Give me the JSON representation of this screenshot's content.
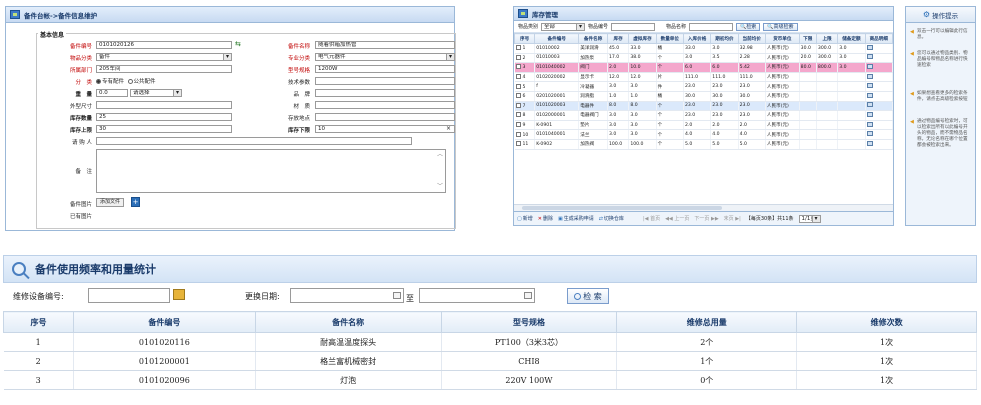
{
  "panel1": {
    "title": "备件台帐->备件信息维护",
    "section": "基本信息",
    "fields": {
      "part_no_label": "备件编号",
      "part_no": "0101020126",
      "part_name_label": "备件名称",
      "part_name": "随着供箱加热管",
      "category_label": "物品分类",
      "category": "备件",
      "major_label": "专业分类",
      "major": "电气元器件",
      "dept_label": "所属部门",
      "dept": "205车间",
      "model_label": "型号规格",
      "model": "1200W",
      "type_label": "分　类",
      "type_opt1": "专有配件",
      "type_opt2": "公共配件",
      "tech_label": "技术参数",
      "weight_label": "重　量",
      "weight": "0.0",
      "weight_unit": "请选择",
      "brand_label": "品　牌",
      "size_label": "外型尺寸",
      "material_label": "材　质",
      "stock_label": "库存数量",
      "stock": "25",
      "location_label": "存放地点",
      "max_label": "库存上限",
      "max": "30",
      "min_label": "库存下限",
      "min": "10",
      "applicant_label": "请 购 人",
      "note_label": "备　注",
      "pic_label": "备件图片",
      "add_file": "添加文件",
      "has_pic_label": "已有图片"
    }
  },
  "panel2": {
    "title": "库存管理",
    "search": {
      "cat_label": "物品类别",
      "cat_value": "全部",
      "code_label": "物品编号",
      "name_label": "物品名称",
      "search_btn": "检索",
      "adv_btn": "高级检索"
    },
    "columns": [
      "序号",
      "备件编号",
      "备件名称",
      "库存",
      "虚拟库存",
      "数量单位",
      "入库价格",
      "期初均价",
      "当前均价",
      "货币单位",
      "下限",
      "上限",
      "储备定额",
      "商品明细"
    ],
    "rows": [
      [
        "1",
        "01010002",
        "美洋润滑",
        "45.0",
        "33.0",
        "桶",
        "33.0",
        "3.0",
        "32.98",
        "人民币(元)",
        "30.0",
        "300.0",
        "3.0",
        ""
      ],
      [
        "2",
        "01010003",
        "加热泵",
        "17.0",
        "38.0",
        "个",
        "3.0",
        "3.5",
        "2.28",
        "人民币(元)",
        "20.0",
        "300.0",
        "3.0",
        ""
      ],
      [
        "3",
        "0101040002",
        "阀门",
        "2.0",
        "10.0",
        "个",
        "6.0",
        "6.0",
        "5.42",
        "人民币(元)",
        "80.0",
        "800.0",
        "3.0",
        ""
      ],
      [
        "4",
        "0102020002",
        "显示卡",
        "12.0",
        "12.0",
        "片",
        "111.0",
        "111.0",
        "111.0",
        "人民币(元)",
        "",
        "",
        "",
        ""
      ],
      [
        "5",
        "f",
        "冷凝器",
        "3.0",
        "3.0",
        "件",
        "23.0",
        "23.0",
        "23.0",
        "人民币(元)",
        "",
        "",
        "",
        ""
      ],
      [
        "6",
        "0201020001",
        "润滑脂",
        "1.0",
        "1.0",
        "桶",
        "30.0",
        "30.0",
        "30.0",
        "人民币(元)",
        "",
        "",
        "",
        ""
      ],
      [
        "7",
        "0101020003",
        "电器件",
        "8.0",
        "8.0",
        "个",
        "23.0",
        "23.0",
        "23.0",
        "人民币(元)",
        "",
        "",
        "",
        ""
      ],
      [
        "8",
        "0102000001",
        "电器阀门",
        "3.0",
        "3.0",
        "个",
        "23.0",
        "23.0",
        "23.0",
        "人民币(元)",
        "",
        "",
        "",
        ""
      ],
      [
        "9",
        "K-0901",
        "垫片",
        "3.0",
        "3.0",
        "个",
        "2.0",
        "2.0",
        "2.0",
        "人民币(元)",
        "",
        "",
        "",
        ""
      ],
      [
        "10",
        "0101040001",
        "法兰",
        "3.0",
        "3.0",
        "个",
        "4.0",
        "4.0",
        "4.0",
        "人民币(元)",
        "",
        "",
        "",
        ""
      ],
      [
        "11",
        "K-0902",
        "加热阀",
        "100.0",
        "100.0",
        "个",
        "5.0",
        "5.0",
        "5.0",
        "人民币(元)",
        "",
        "",
        "",
        ""
      ]
    ],
    "footer": {
      "add": "新增",
      "del": "删除",
      "gen": "生成采购申请",
      "switch": "切换仓库",
      "first": "首页",
      "prev": "上一页",
      "next": "下一页",
      "last": "末页",
      "page_info": "【每页30条】共11条",
      "page_sel": "1/1页"
    }
  },
  "panel3": {
    "title": "操作提示",
    "tips": [
      "双击一行可以编辑此行信息。",
      "您可以通过物品类别、物品编号和物品名称进行快速检索",
      "如果想查看更多的检索条件，请点击高级检索按钮",
      "通过物品编号检索时，可以检索出所有以此编号开头的物品，而不需物品名称，无论名称在哪个位置都会被检索出来。"
    ]
  },
  "panel4": {
    "title": "备件使用频率和用量统计",
    "device_label": "维修设备编号:",
    "date_label": "更换日期:",
    "to_label": "至",
    "search_btn": "检 索",
    "columns": [
      "序号",
      "备件编号",
      "备件名称",
      "型号规格",
      "维修总用量",
      "维修次数"
    ],
    "rows": [
      [
        "1",
        "0101020116",
        "耐高温温度探头",
        "PT100（3米3芯）",
        "2个",
        "1次"
      ],
      [
        "2",
        "0101200001",
        "格兰富机械密封",
        "CHI8",
        "1个",
        "1次"
      ],
      [
        "3",
        "0101020096",
        "灯泡",
        "220V 100W",
        "0个",
        "1次"
      ]
    ]
  }
}
